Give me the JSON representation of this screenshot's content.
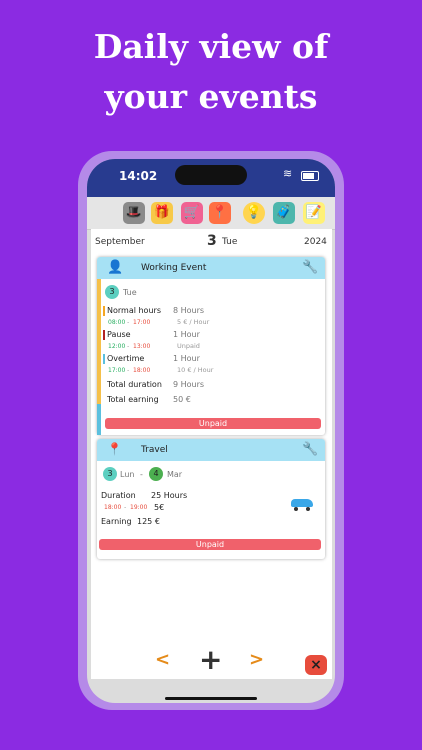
{
  "headline": [
    "Daily view of",
    "your events"
  ],
  "status": {
    "time": "14:02"
  },
  "toolbar": {
    "icons": [
      "hat-person-icon",
      "gift-hand-icon",
      "shopping-cart-icon",
      "location-pins-icon",
      "light-bulb-icon",
      "suitcase-icon",
      "sticky-note-icon"
    ]
  },
  "datebar": {
    "month": "September",
    "day": "3",
    "weekday": "Tue",
    "year": "2024"
  },
  "work_card": {
    "title": "Working Event",
    "date_day": "3",
    "date_weekday": "Tue",
    "rows": [
      {
        "label": "Normal hours",
        "value": "8 Hours",
        "from": "08:00",
        "sep": "-",
        "to": "17:00",
        "rate": "5 € / Hour",
        "color": "#f5a623"
      },
      {
        "label": "Pause",
        "value": "1 Hour",
        "from": "12:00",
        "sep": "-",
        "to": "13:00",
        "rate": "Unpaid",
        "color": "#b22222"
      },
      {
        "label": "Overtime",
        "value": "1 Hour",
        "from": "17:00",
        "sep": "-",
        "to": "18:00",
        "rate": "10 € / Hour",
        "color": "#5bc0de"
      }
    ],
    "total_duration_label": "Total duration",
    "total_duration_value": "9 Hours",
    "total_earning_label": "Total earning",
    "total_earning_value": "50 €",
    "status": "Unpaid"
  },
  "travel_card": {
    "title": "Travel",
    "start_day": "3",
    "start_weekday": "Lun",
    "dash": "-",
    "end_day": "4",
    "end_weekday": "Mar",
    "duration_label": "Duration",
    "duration_value": "25 Hours",
    "from": "18:00",
    "sep": "-",
    "to": "19:00",
    "price": "5€",
    "earning_label": "Earning",
    "earning_value": "125 €",
    "status": "Unpaid"
  },
  "nav": {
    "prev": "<",
    "add": "+",
    "next": ">",
    "close": "×"
  },
  "colors": {
    "background": "#8b2be2",
    "header": "#a6e1f4",
    "unpaid": "#f0616b",
    "arrow": "#e58b1a"
  }
}
